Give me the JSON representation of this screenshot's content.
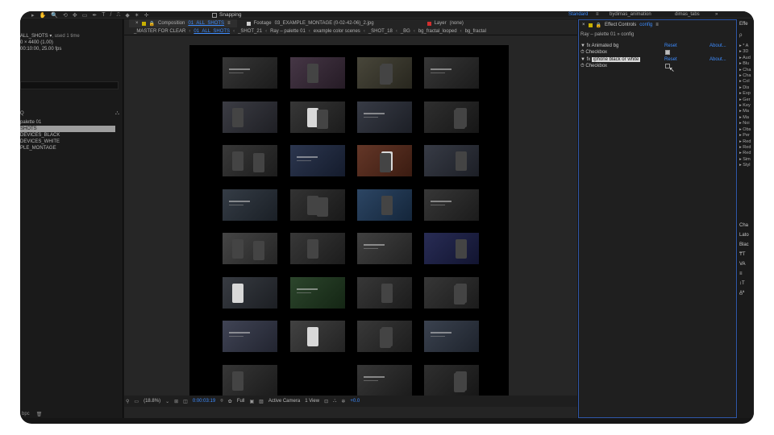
{
  "toolbar": {
    "tools": [
      "▸",
      "✋",
      "🔍",
      "⟲",
      "✥",
      "▭",
      "✒",
      "T",
      "/",
      "⎍",
      "◆",
      "✶",
      "✛"
    ],
    "snapping_label": "Snapping",
    "workspaces": [
      {
        "label": "Standard",
        "active": true
      },
      {
        "label": "≡",
        "active": false
      },
      {
        "label": "bydimas_animation",
        "active": false
      },
      {
        "label": "dimas_tabs",
        "active": false
      },
      {
        "label": "»",
        "active": false
      }
    ]
  },
  "project": {
    "comp_name": "ALL_SHOTS ▾",
    "used": ", used 1 time",
    "dimensions": "0 × 4400 (1.00)",
    "duration": "00:10:00, 25.00 fps",
    "search_label": "Q",
    "items": [
      {
        "label": "palette 01",
        "selected": false
      },
      {
        "label": "SHOTS",
        "selected": true
      },
      {
        "label": "DEVICES_BLACK",
        "selected": false
      },
      {
        "label": "DEVICES_WHITE",
        "selected": false
      },
      {
        "label": "PLE_MONTAGE",
        "selected": false
      }
    ]
  },
  "composition": {
    "tabs": [
      {
        "prefix": "Composition",
        "name": "01_ALL_SHOTS",
        "color": "#c9b000",
        "active": true
      },
      {
        "prefix": "Footage",
        "name": "03_EXAMPLE_MONTAGE (0-02-42-06)_2.jpg",
        "color": "#cfcfcf",
        "active": false
      },
      {
        "prefix": "Layer",
        "name": "(none)",
        "color": "#d32f2f",
        "active": false
      }
    ],
    "breadcrumbs": [
      {
        "label": "_MASTER FOR CLEAR",
        "active": false
      },
      {
        "label": "01_ALL_SHOTS",
        "active": true
      },
      {
        "label": "_SHOT_21",
        "active": false
      },
      {
        "label": "Ray – palette 01",
        "active": false
      },
      {
        "label": "example color scenes",
        "active": false
      },
      {
        "label": "_SHOT_18",
        "active": false
      },
      {
        "label": "_BG",
        "active": false
      },
      {
        "label": "bg_fractal_looped",
        "active": false
      },
      {
        "label": "bg_fractal",
        "active": false
      }
    ],
    "viewer_bar": {
      "zoom": "(18.8%)",
      "timecode": "0:00:03:19",
      "resolution": "Full",
      "camera": "Active Camera",
      "views": "1 View",
      "exposure": "+0.0"
    }
  },
  "effect_controls": {
    "tab_label": "Effect Controls",
    "tab_target": "config",
    "path": "Ray – palette 01 » config",
    "effects": [
      {
        "name": "Animated bg",
        "reset": "Reset",
        "about": "About...",
        "prop": "Checkbox",
        "checked": true,
        "highlighted": false
      },
      {
        "name": "iphone black or white",
        "reset": "Reset",
        "about": "About...",
        "prop": "Checkbox",
        "checked": false,
        "highlighted": true
      }
    ]
  },
  "presets": {
    "title": "Effe",
    "search": "ρ",
    "items": [
      "▸ * A",
      "▸ 3D",
      "▸ Aud",
      "▸ Blu",
      "▸ Cha",
      "▸ Cha",
      "▸ Col",
      "▸ Dis",
      "▸ Exp",
      "▸ Ger",
      "▸ Key",
      "▸ Ma",
      "▸ Ma",
      "▸ Noi",
      "▸ Obs",
      "▸ Per",
      "▸ Red",
      "▸ Red",
      "▸ Red",
      "▸ Sim",
      "▸ Styl"
    ],
    "character": [
      "Cha",
      "Lato",
      "Blac",
      "₸T",
      "VA",
      "≡",
      "↕T",
      "A̲ª"
    ]
  }
}
